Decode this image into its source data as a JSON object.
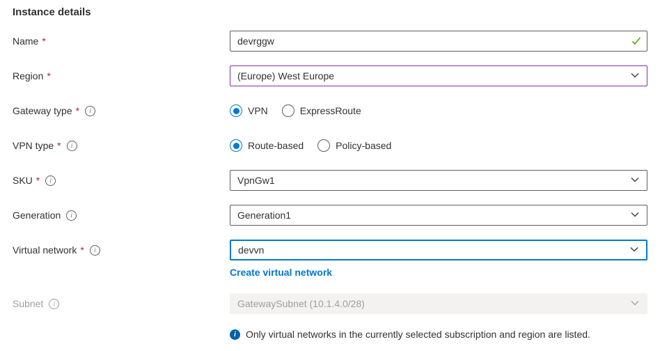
{
  "title": "Instance details",
  "required_marker": "*",
  "fields": {
    "name": {
      "label": "Name",
      "required": "*",
      "value": "devrggw",
      "valid": true
    },
    "region": {
      "label": "Region",
      "required": "*",
      "value": "(Europe) West Europe",
      "state": "edited"
    },
    "gateway_type": {
      "label": "Gateway type",
      "required": "*",
      "options": [
        {
          "label": "VPN",
          "selected": true
        },
        {
          "label": "ExpressRoute",
          "selected": false
        }
      ]
    },
    "vpn_type": {
      "label": "VPN type",
      "required": "*",
      "options": [
        {
          "label": "Route-based",
          "selected": true
        },
        {
          "label": "Policy-based",
          "selected": false
        }
      ]
    },
    "sku": {
      "label": "SKU",
      "required": "*",
      "value": "VpnGw1"
    },
    "generation": {
      "label": "Generation",
      "value": "Generation1"
    },
    "virtual_network": {
      "label": "Virtual network",
      "required": "*",
      "value": "devvn",
      "state": "focused",
      "link_label": "Create virtual network"
    },
    "subnet": {
      "label": "Subnet",
      "value": "GatewaySubnet (10.1.4.0/28)",
      "disabled": true
    }
  },
  "note": {
    "text": "Only virtual networks in the currently selected subscription and region are listed."
  },
  "colors": {
    "accent_blue": "#0078d4",
    "edited_purple": "#8a2da5",
    "valid_green": "#57a300",
    "required_red": "#a4262c",
    "disabled_gray": "#a19f9d",
    "disabled_bg": "#f3f2f1"
  }
}
